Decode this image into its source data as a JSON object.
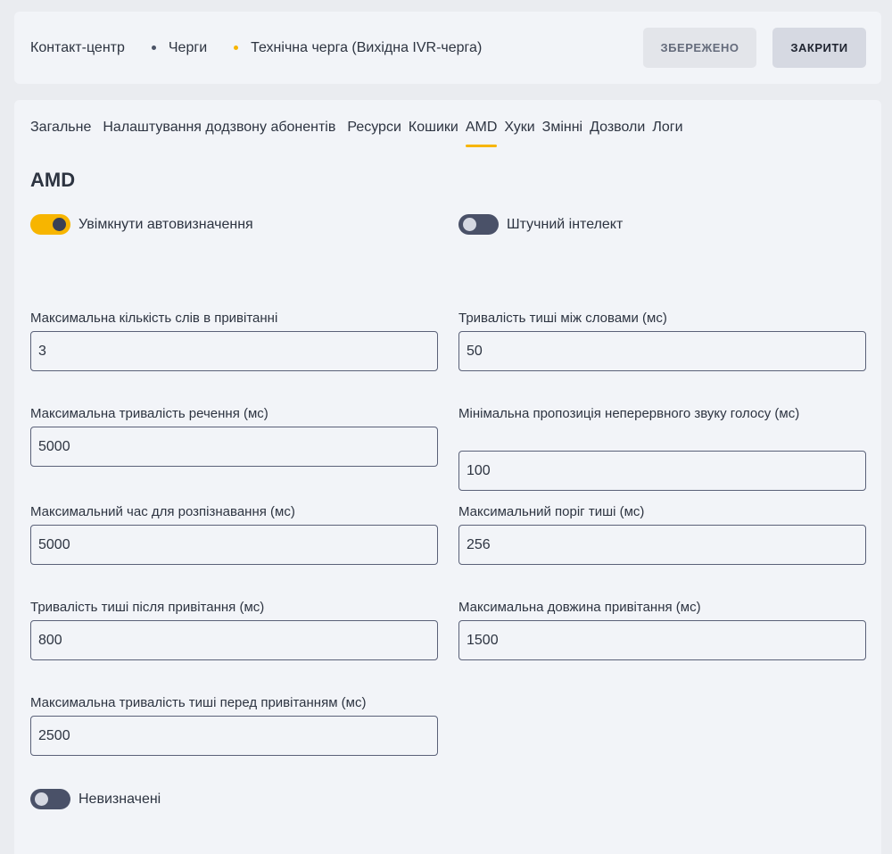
{
  "breadcrumb": {
    "items": [
      "Контакт-центр",
      "Черги",
      "Технічна черга (Вихідна IVR-черга)"
    ]
  },
  "actions": {
    "saved_label": "ЗБЕРЕЖЕНО",
    "close_label": "ЗАКРИТИ"
  },
  "tabs": [
    {
      "label": "Загальне",
      "active": false
    },
    {
      "label": "Налаштування додзвону абонентів",
      "active": false
    },
    {
      "label": "Ресурси",
      "active": false
    },
    {
      "label": "Кошики",
      "active": false
    },
    {
      "label": "AMD",
      "active": true
    },
    {
      "label": "Хуки",
      "active": false
    },
    {
      "label": "Змінні",
      "active": false
    },
    {
      "label": "Дозволи",
      "active": false
    },
    {
      "label": "Логи",
      "active": false
    }
  ],
  "section": {
    "title": "AMD"
  },
  "toggles": {
    "auto_detect": {
      "label": "Увімкнути автовизначення",
      "on": true
    },
    "ai": {
      "label": "Штучний інтелект",
      "on": false
    },
    "undetermined": {
      "label": "Невизначені",
      "on": false
    }
  },
  "fields": {
    "max_words_greeting": {
      "label": "Максимальна кількість слів в привітанні",
      "value": "3"
    },
    "silence_between_words": {
      "label": "Тривалість тиші між словами (мс)",
      "value": "50"
    },
    "max_sentence_duration": {
      "label": "Максимальна тривалість речення (мс)",
      "value": "5000"
    },
    "min_voice_proportion": {
      "label": "Мінімальна пропозиція неперервного звуку голосу (мс)",
      "value": "100"
    },
    "max_recognition_time": {
      "label": "Максимальний час для розпізнавання (мс)",
      "value": "5000"
    },
    "max_silence_threshold": {
      "label": "Максимальний поріг тиші (мс)",
      "value": "256"
    },
    "silence_after_greeting": {
      "label": "Тривалість тиші після привітання (мс)",
      "value": "800"
    },
    "max_greeting_length": {
      "label": "Максимальна довжина привітання (мс)",
      "value": "1500"
    },
    "max_silence_before_greeting": {
      "label": "Максимальна тривалість тиші перед привітанням (мс)",
      "value": "2500"
    }
  },
  "colors": {
    "accent": "#f7b500",
    "toggle_off": "#4a5168",
    "panel_bg": "#f2f4f8",
    "page_bg": "#eaecf0"
  }
}
